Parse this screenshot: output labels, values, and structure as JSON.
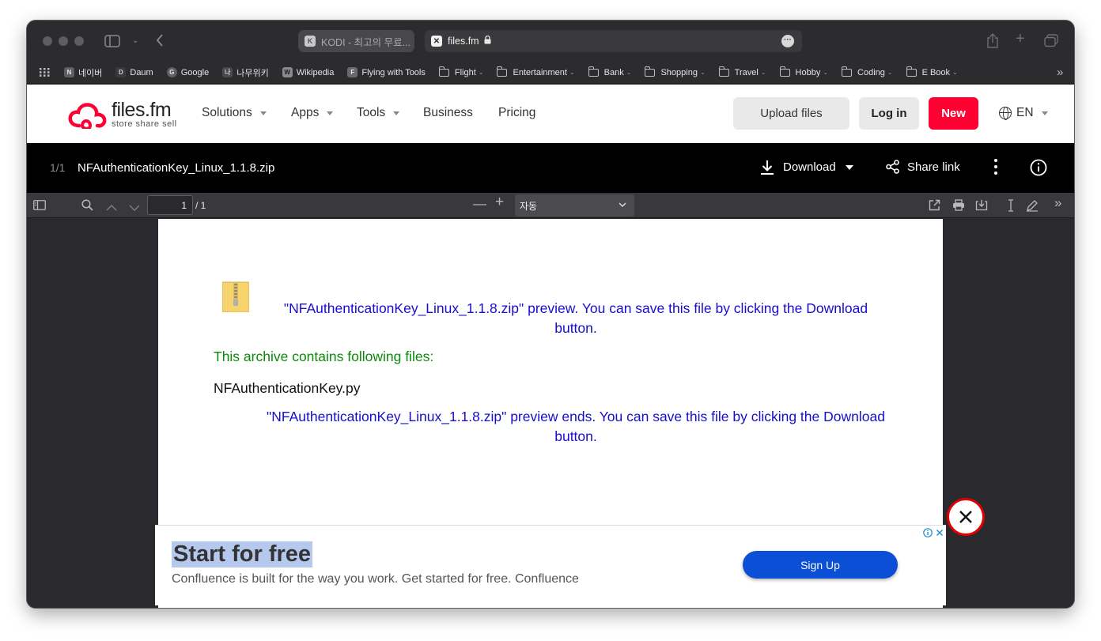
{
  "browser": {
    "tabs": [
      {
        "title": "KODI - 최고의 무료..."
      },
      {
        "title": "files.fm"
      }
    ],
    "active_tab_menu": "···"
  },
  "bookmarks": [
    {
      "label": "네이버",
      "kind": "site",
      "badge": "N"
    },
    {
      "label": "Daum",
      "kind": "site",
      "badge": "D"
    },
    {
      "label": "Google",
      "kind": "site",
      "badge": "G"
    },
    {
      "label": "나무위키",
      "kind": "site",
      "badge": "나"
    },
    {
      "label": "Wikipedia",
      "kind": "site",
      "badge": "W"
    },
    {
      "label": "Flying with Tools",
      "kind": "site",
      "badge": "F"
    },
    {
      "label": "Flight",
      "kind": "folder"
    },
    {
      "label": "Entertainment",
      "kind": "folder"
    },
    {
      "label": "Bank",
      "kind": "folder"
    },
    {
      "label": "Shopping",
      "kind": "folder"
    },
    {
      "label": "Travel",
      "kind": "folder"
    },
    {
      "label": "Hobby",
      "kind": "folder"
    },
    {
      "label": "Coding",
      "kind": "folder"
    },
    {
      "label": "E Book",
      "kind": "folder"
    }
  ],
  "site": {
    "logo": {
      "name": "files.fm",
      "tagline": "store share sell"
    },
    "nav": {
      "solutions": "Solutions",
      "apps": "Apps",
      "tools": "Tools",
      "business": "Business",
      "pricing": "Pricing"
    },
    "upload_label": "Upload files",
    "login_label": "Log in",
    "new_label": "New",
    "language": "EN",
    "colors": {
      "brand_red": "#ff0033"
    }
  },
  "file": {
    "count": "1/1",
    "name": "NFAuthenticationKey_Linux_1.1.8.zip",
    "download_label": "Download",
    "share_label": "Share link"
  },
  "pdf_toolbar": {
    "page_current": "1",
    "page_total": "/ 1",
    "zoom": "자동"
  },
  "preview": {
    "start_line_1": "\"NFAuthenticationKey_Linux_1.1.8.zip\" preview. You can save this file by clicking the Download",
    "start_line_2": "button.",
    "contains": "This archive contains following files:",
    "files": [
      "NFAuthenticationKey.py"
    ],
    "end_line_1": "\"NFAuthenticationKey_Linux_1.1.8.zip\" preview ends. You can save this file by clicking the Download",
    "end_line_2": "button."
  },
  "ad": {
    "title": "Start for free",
    "text": "Confluence is built for the way you work. Get started for free. Confluence",
    "cta": "Sign Up",
    "close_symbol": "✕"
  }
}
